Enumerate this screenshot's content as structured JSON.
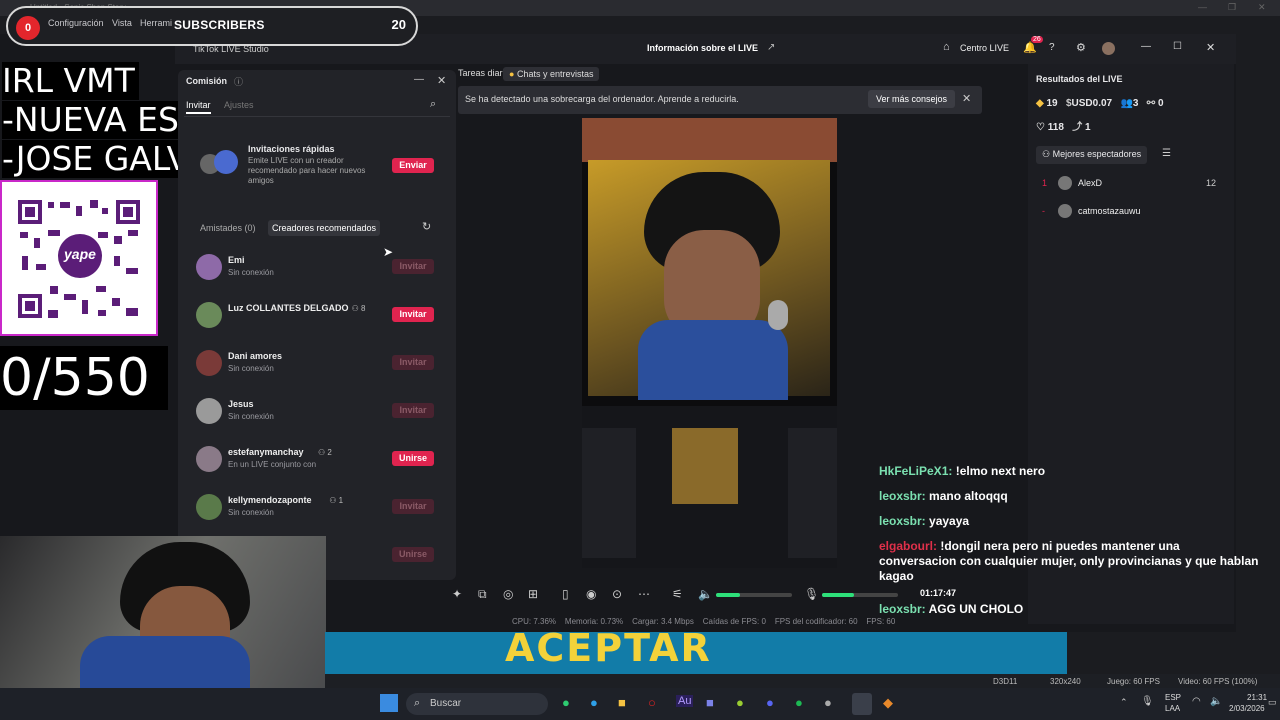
{
  "os_title": "Untitled - Sonic Shop Story...",
  "overlay": {
    "sub_badge": "0",
    "sub_label": "SUBSCRIBERS",
    "sub_count": "20",
    "irl_lines": [
      "IRL VMT",
      "-NUEVA ESPERANZA",
      "-JOSE GALVEZ"
    ],
    "qr_caption": "yape",
    "goal": "0/550"
  },
  "menu": [
    "Configuración",
    "Vista",
    "Herramientas"
  ],
  "app_title": "TikTok LIVE Studio",
  "header": {
    "info_live": "Información sobre el LIVE",
    "centro": "Centro LIVE",
    "notif_count": "26"
  },
  "tabs": [
    "Tareas diarias",
    "Chats y entrevistas"
  ],
  "alert": {
    "text": "Se ha detectado una sobrecarga del ordenador. Aprende a reducirla.",
    "action": "Ver más consejos"
  },
  "panel": {
    "title": "Comisión",
    "tabs": [
      "Invitar",
      "Ajustes"
    ],
    "quick": {
      "title": "Invitaciones rápidas",
      "desc": "Emite LIVE con un creador recomendado para hacer nuevos amigos",
      "button": "Enviar"
    },
    "subtabs": [
      "Amistades (0)",
      "Creadores recomendados"
    ],
    "rows": [
      {
        "name": "Emi",
        "sub": "Sin conexión",
        "button": "Invitar",
        "active": false,
        "color": "#8e6aa8"
      },
      {
        "name": "Luz COLLANTES DELGADO",
        "badge": "8",
        "sub": "",
        "button": "Invitar",
        "active": true,
        "color": "#6a8a5a"
      },
      {
        "name": "Dani amores",
        "sub": "Sin conexión",
        "button": "Invitar",
        "active": false,
        "color": "#7a3a38"
      },
      {
        "name": "Jesus",
        "sub": "Sin conexión",
        "button": "Invitar",
        "active": false,
        "color": "#9a9a9a"
      },
      {
        "name": "estefanymanchay",
        "badge": "2",
        "sub": "En un LIVE conjunto con",
        "button": "Unirse",
        "active": true,
        "color": "#8a7a88"
      },
      {
        "name": "kellymendozaponte",
        "badge": "1",
        "sub": "Sin conexión",
        "button": "Invitar",
        "active": false,
        "color": "#5a7a4a"
      },
      {
        "name": "",
        "sub": "",
        "button": "Unirse",
        "active": false,
        "color": "#444"
      }
    ]
  },
  "right": {
    "title": "Resultados del LIVE",
    "stats1": [
      "19",
      "USD0.07",
      "3",
      "0"
    ],
    "stats2": [
      "118",
      "1"
    ],
    "viewers_label": "Mejores espectadores",
    "viewers": [
      {
        "rank": "1",
        "name": "AlexD",
        "score": "12"
      },
      {
        "rank": "-",
        "name": "catmostazauwu",
        "score": ""
      }
    ]
  },
  "chat": [
    {
      "user": "HkFeLiPeX1:",
      "msg": "!elmo next nero",
      "color": "#7be0b0"
    },
    {
      "user": "leoxsbr:",
      "msg": "mano altoqqq",
      "color": "#7be0b0"
    },
    {
      "user": "leoxsbr:",
      "msg": "yayaya",
      "color": "#7be0b0"
    },
    {
      "user": "elgabourl:",
      "msg": "!dongil nera pero ni puedes mantener una conversacion con cualquier mujer, only provincianas y que hablan kagao",
      "color": "#e0304a"
    },
    {
      "user": "leoxsbr:",
      "msg": "AGG UN CHOLO",
      "color": "#7be0b0"
    }
  ],
  "timer": "01:17:47",
  "stats_bar": [
    "CPU: 7.36%",
    "Memoria: 0.73%",
    "Cargar: 3.4 Mbps",
    "Caídas de FPS: 0",
    "FPS del codificador: 60",
    "FPS: 60"
  ],
  "banner_text": "ACEPTAR",
  "status_row": [
    "D3D11",
    "320x240",
    "Juego: 60 FPS",
    "Video: 60 FPS (100%)"
  ],
  "taskbar": {
    "search": "Buscar",
    "lang": "ESP",
    "lang2": "LAA",
    "time": "21:31",
    "date": "2/03/2026"
  }
}
